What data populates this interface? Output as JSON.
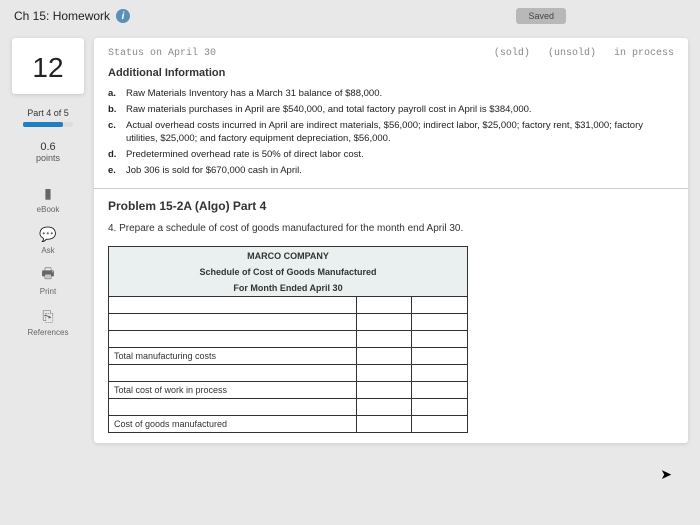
{
  "header": {
    "chapter": "Ch 15: Homework",
    "saved": "Saved"
  },
  "sidebar": {
    "qnum": "12",
    "part_label": "Part 4 of 5",
    "progress_pct": 80,
    "points_val": "0.6",
    "points_label": "points",
    "tools": {
      "ebook": "eBook",
      "ask": "Ask",
      "print": "Print",
      "references": "References"
    }
  },
  "status": {
    "left": "Status on April 30",
    "sold": "(sold)",
    "unsold": "(unsold)",
    "process": "in process"
  },
  "info": {
    "heading": "Additional Information",
    "a": "Raw Materials Inventory has a March 31 balance of $88,000.",
    "b": "Raw materials purchases in April are $540,000, and total factory payroll cost in April is $384,000.",
    "c": "Actual overhead costs incurred in April are indirect materials, $56,000; indirect labor, $25,000; factory rent, $31,000; factory utilities, $25,000; and factory equipment depreciation, $56,000.",
    "d": "Predetermined overhead rate is 50% of direct labor cost.",
    "e": "Job 306 is sold for $670,000 cash in April."
  },
  "problem": {
    "title": "Problem 15-2A (Algo) Part 4",
    "instruction": "4. Prepare a schedule of cost of goods manufactured for the month end April 30."
  },
  "schedule": {
    "company": "MARCO COMPANY",
    "title": "Schedule of Cost of Goods Manufactured",
    "period": "For Month Ended April 30",
    "rows": {
      "r4": "Total manufacturing costs",
      "r6": "Total cost of work in process",
      "r8": "Cost of goods manufactured"
    }
  }
}
